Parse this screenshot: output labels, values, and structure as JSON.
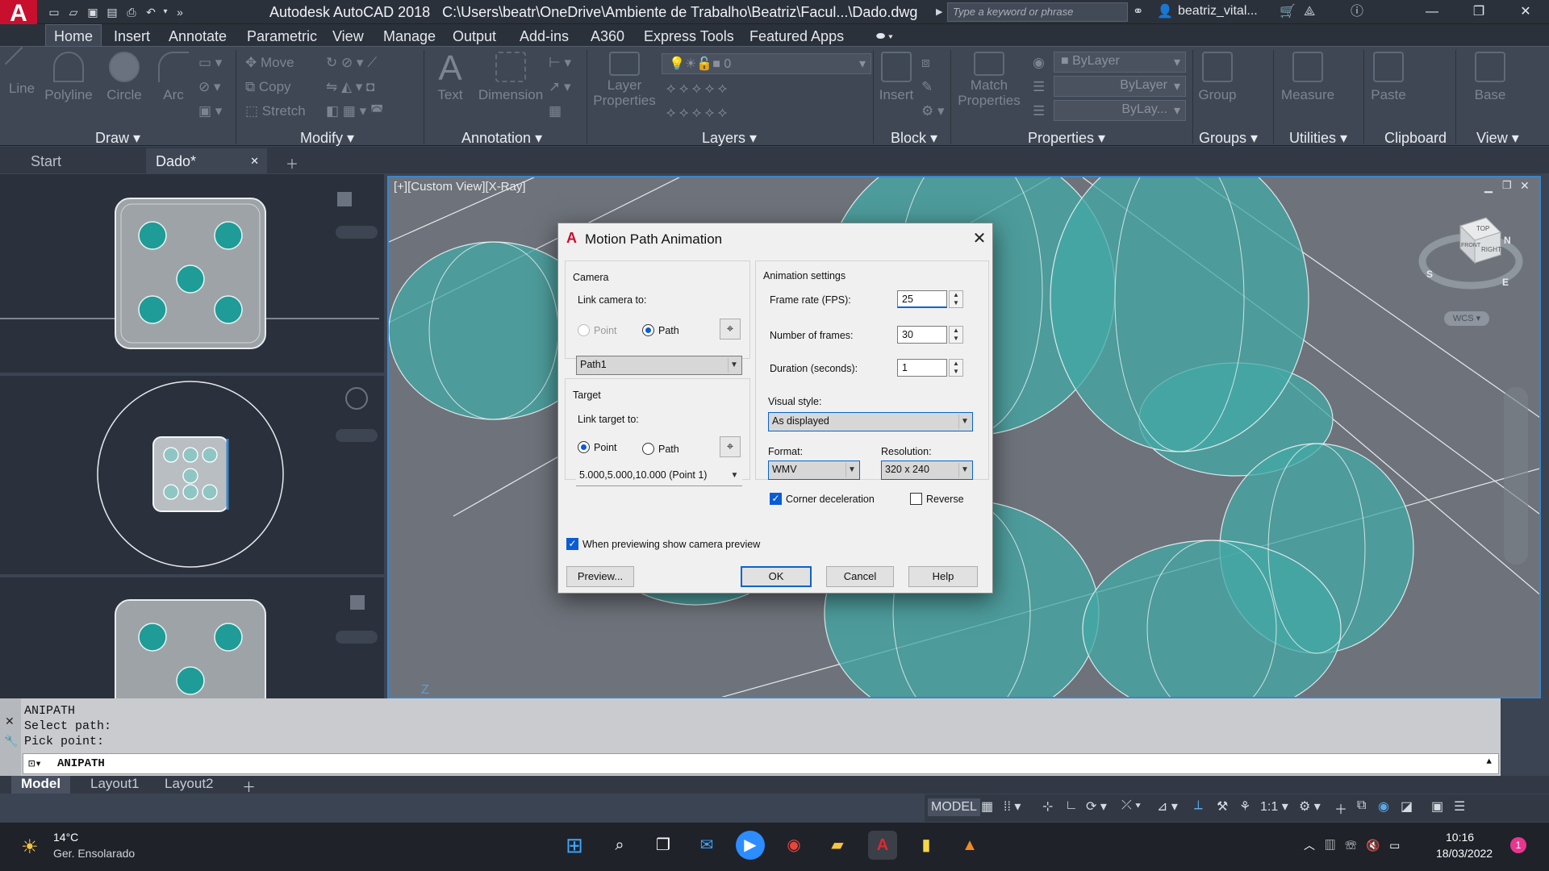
{
  "titlebar": {
    "app_name": "Autodesk AutoCAD 2018",
    "path": "C:\\Users\\beatr\\OneDrive\\Ambiente de Trabalho\\Beatriz\\Facul...\\Dado.dwg",
    "search_placeholder": "Type a keyword or phrase",
    "user": "beatriz_vital...",
    "logo": "A"
  },
  "menu_tabs": [
    "Home",
    "Insert",
    "Annotate",
    "Parametric",
    "View",
    "Manage",
    "Output",
    "Add-ins",
    "A360",
    "Express Tools",
    "Featured Apps"
  ],
  "ribbon": {
    "draw_tools": [
      "Line",
      "Polyline",
      "Circle",
      "Arc"
    ],
    "modify_tools": [
      "Move",
      "Copy",
      "Stretch"
    ],
    "annotation_tools": [
      "Text",
      "Dimension"
    ],
    "layer_tools": [
      "Layer Properties"
    ],
    "layer_value": "0",
    "block_tools": [
      "Insert"
    ],
    "properties_tools": [
      "Match Properties"
    ],
    "bylayer_color": "ByLayer",
    "bylayer_line": "ByLayer",
    "bylayer_line2": "ByLay...",
    "groups_tools": [
      "Group"
    ],
    "utilities_tools": [
      "Measure"
    ],
    "clipboard_tools": [
      "Paste"
    ],
    "view_tools": [
      "Base"
    ],
    "panels": [
      "Draw",
      "Modify",
      "Annotation",
      "Layers",
      "Block",
      "Properties",
      "Groups",
      "Utilities",
      "Clipboard",
      "View"
    ]
  },
  "doc_tabs": {
    "start": "Start",
    "active": "Dado*"
  },
  "viewport": {
    "label": "[+][Custom View][X-Ray]",
    "wcs": "WCS"
  },
  "viewcube": {
    "top": "TOP",
    "front": "FRONT",
    "right": "RIGHT",
    "n": "N",
    "s": "S",
    "e": "E"
  },
  "command": {
    "history": [
      "ANIPATH",
      "Select path:",
      "Pick point:"
    ],
    "current": "ANIPATH"
  },
  "layout_tabs": [
    "Model",
    "Layout1",
    "Layout2"
  ],
  "statusbar": {
    "model": "MODEL",
    "scale": "1:1"
  },
  "taskbar": {
    "temp": "14°C",
    "weather": "Ger. Ensolarado",
    "time": "10:16",
    "date": "18/03/2022",
    "badge": "1"
  },
  "dialog": {
    "title": "Motion Path Animation",
    "camera_group": "Camera",
    "link_camera_to": "Link camera to:",
    "camera_point": "Point",
    "camera_path": "Path",
    "camera_path_value": "Path1",
    "target_group": "Target",
    "link_target_to": "Link target to:",
    "target_point": "Point",
    "target_path": "Path",
    "target_point_value": "5.000,5.000,10.000  (Point 1)",
    "animation_settings": "Animation settings",
    "frame_rate_label": "Frame rate (FPS):",
    "frame_rate_value": "25",
    "frames_label": "Number of frames:",
    "frames_value": "30",
    "duration_label": "Duration (seconds):",
    "duration_value": "1",
    "visual_style_label": "Visual style:",
    "visual_style_value": "As displayed",
    "format_label": "Format:",
    "format_value": "WMV",
    "resolution_label": "Resolution:",
    "resolution_value": "320 x 240",
    "corner_decel": "Corner deceleration",
    "reverse": "Reverse",
    "preview_check": "When previewing show camera preview",
    "preview_btn": "Preview...",
    "ok_btn": "OK",
    "cancel_btn": "Cancel",
    "help_btn": "Help"
  },
  "colors": {
    "accent": "#0a5bd6",
    "teal": "#2aa7a3",
    "autocad_red": "#c8102e"
  }
}
